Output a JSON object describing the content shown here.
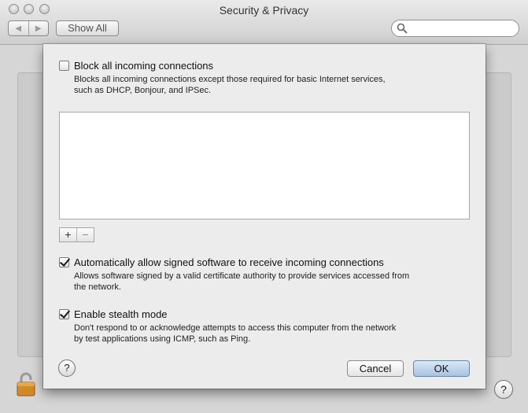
{
  "window": {
    "title": "Security & Privacy",
    "nav_back": "◀",
    "nav_forward": "▶",
    "show_all": "Show All",
    "search": {
      "value": "",
      "placeholder": ""
    }
  },
  "sheet": {
    "block_all": {
      "label": "Block all incoming connections",
      "checked": false,
      "desc_line1": "Blocks all incoming connections except those required for basic Internet services,",
      "desc_line2": "such as DHCP, Bonjour, and IPSec."
    },
    "list_controls": {
      "add": "+",
      "remove": "−"
    },
    "auto_allow": {
      "label": "Automatically allow signed software to receive incoming connections",
      "checked": true,
      "desc_line1": "Allows software signed by a valid certificate authority to provide services accessed from",
      "desc_line2": "the network."
    },
    "stealth": {
      "label": "Enable stealth mode",
      "checked": true,
      "desc_line1": "Don't respond to or acknowledge attempts to access this computer from the network",
      "desc_line2": "by test applications using ICMP, such as Ping."
    },
    "help": "?",
    "cancel": "Cancel",
    "ok": "OK"
  },
  "background": {
    "help": "?"
  },
  "icons": {
    "search": "magnifier-icon",
    "lock": "lock-icon",
    "help": "question-mark-icon"
  },
  "colors": {
    "ok_button": "#a7c2e0",
    "lock": "#d18a2a"
  }
}
